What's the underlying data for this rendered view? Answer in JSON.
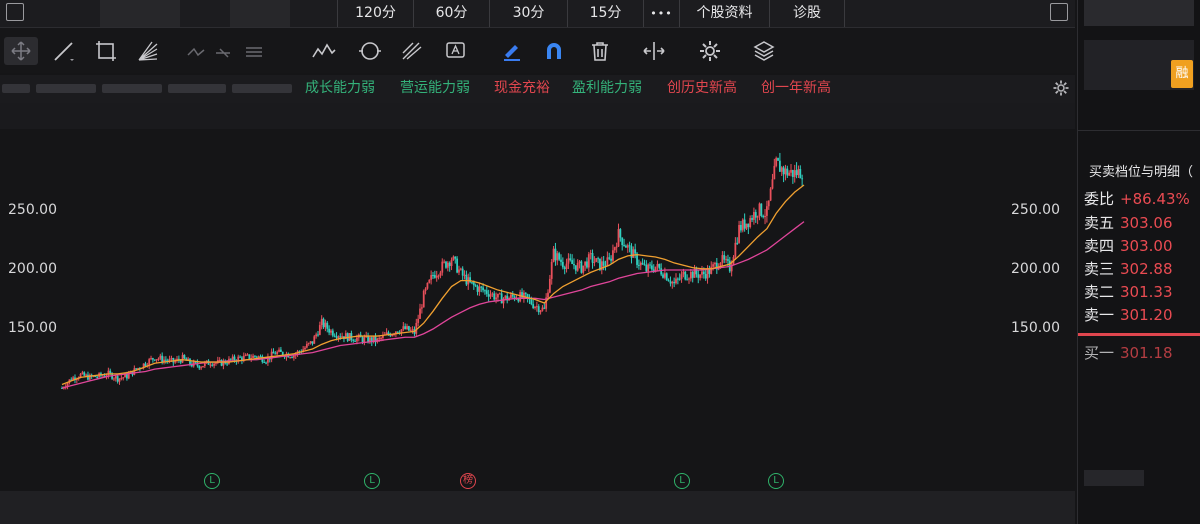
{
  "periods": [
    "120分",
    "60分",
    "30分",
    "15分"
  ],
  "more_label": "•••",
  "stock_info_label": "个股资料",
  "diagnose_label": "诊股",
  "tags": [
    {
      "label": "成长能力弱",
      "color": "green"
    },
    {
      "label": "营运能力弱",
      "color": "green"
    },
    {
      "label": "现金充裕",
      "color": "red"
    },
    {
      "label": "盈利能力弱",
      "color": "green"
    },
    {
      "label": "创历史新高",
      "color": "red"
    },
    {
      "label": "创一年新高",
      "color": "red"
    }
  ],
  "colors": {
    "up": "#e8505b",
    "down": "#2fd0c0",
    "ma_short": "#f0a030",
    "ma_long": "#e0459a",
    "tag_green": "#34b27a",
    "tag_red": "#e0464e"
  },
  "chart_data": {
    "type": "candlestick",
    "y_ticks_left": [
      "250.00",
      "200.00",
      "150.00"
    ],
    "y_ticks_right": [
      "250.00",
      "200.00",
      "150.00"
    ],
    "ylim": [
      90,
      315
    ],
    "close": [
      100,
      108,
      111,
      109,
      110,
      112,
      108,
      110,
      116,
      121,
      126,
      124,
      122,
      125,
      120,
      119,
      122,
      121,
      123,
      125,
      126,
      127,
      124,
      130,
      129,
      128,
      133,
      139,
      155,
      148,
      145,
      143,
      142,
      141,
      140,
      145,
      149,
      150,
      147,
      178,
      196,
      203,
      210,
      197,
      188,
      184,
      181,
      176,
      176,
      178,
      176,
      170,
      166,
      214,
      206,
      205,
      202,
      210,
      204,
      207,
      230,
      219,
      208,
      200,
      203,
      197,
      188,
      196,
      197,
      196,
      200,
      209,
      202,
      235,
      242,
      251,
      248,
      290,
      283,
      282,
      284
    ],
    "ma_short": [
      103,
      106,
      109,
      110,
      111,
      112,
      112,
      113,
      115,
      118,
      121,
      122,
      123,
      124,
      123,
      122,
      122,
      122,
      122,
      123,
      124,
      125,
      126,
      127,
      128,
      129,
      131,
      133,
      137,
      140,
      142,
      143,
      144,
      144,
      144,
      145,
      146,
      147,
      148,
      155,
      165,
      176,
      186,
      191,
      191,
      189,
      186,
      183,
      181,
      179,
      177,
      175,
      172,
      180,
      186,
      190,
      194,
      198,
      201,
      204,
      209,
      212,
      213,
      212,
      211,
      209,
      206,
      204,
      202,
      201,
      201,
      203,
      205,
      212,
      220,
      228,
      235,
      248,
      258,
      266,
      272
    ],
    "ma_long": [
      100,
      102,
      104,
      106,
      108,
      110,
      111,
      112,
      113,
      114,
      116,
      117,
      118,
      119,
      120,
      121,
      122,
      122,
      123,
      123,
      124,
      124,
      125,
      126,
      127,
      128,
      129,
      130,
      132,
      134,
      136,
      137,
      138,
      139,
      140,
      141,
      142,
      143,
      143,
      146,
      150,
      155,
      160,
      164,
      168,
      171,
      173,
      174,
      175,
      176,
      176,
      176,
      175,
      177,
      179,
      181,
      183,
      186,
      188,
      190,
      193,
      195,
      197,
      198,
      199,
      200,
      200,
      200,
      200,
      200,
      201,
      202,
      203,
      206,
      209,
      213,
      217,
      223,
      229,
      235,
      241
    ],
    "markers": [
      {
        "label": "L",
        "type": "green"
      },
      {
        "label": "L",
        "type": "green"
      },
      {
        "label": "榜",
        "type": "red"
      },
      {
        "label": "L",
        "type": "green"
      },
      {
        "label": "L",
        "type": "green"
      }
    ]
  },
  "right_panel": {
    "badge": "融",
    "title": "买卖档位与明细（",
    "weibi_label": "委比",
    "weibi_value": "+86.43%",
    "asks": [
      {
        "label": "卖五",
        "price": "303.06"
      },
      {
        "label": "卖四",
        "price": "303.00"
      },
      {
        "label": "卖三",
        "price": "302.88"
      },
      {
        "label": "卖二",
        "price": "301.33"
      },
      {
        "label": "卖一",
        "price": "301.20"
      }
    ],
    "bid_partial": {
      "label": "买一",
      "price": "301.18"
    }
  }
}
